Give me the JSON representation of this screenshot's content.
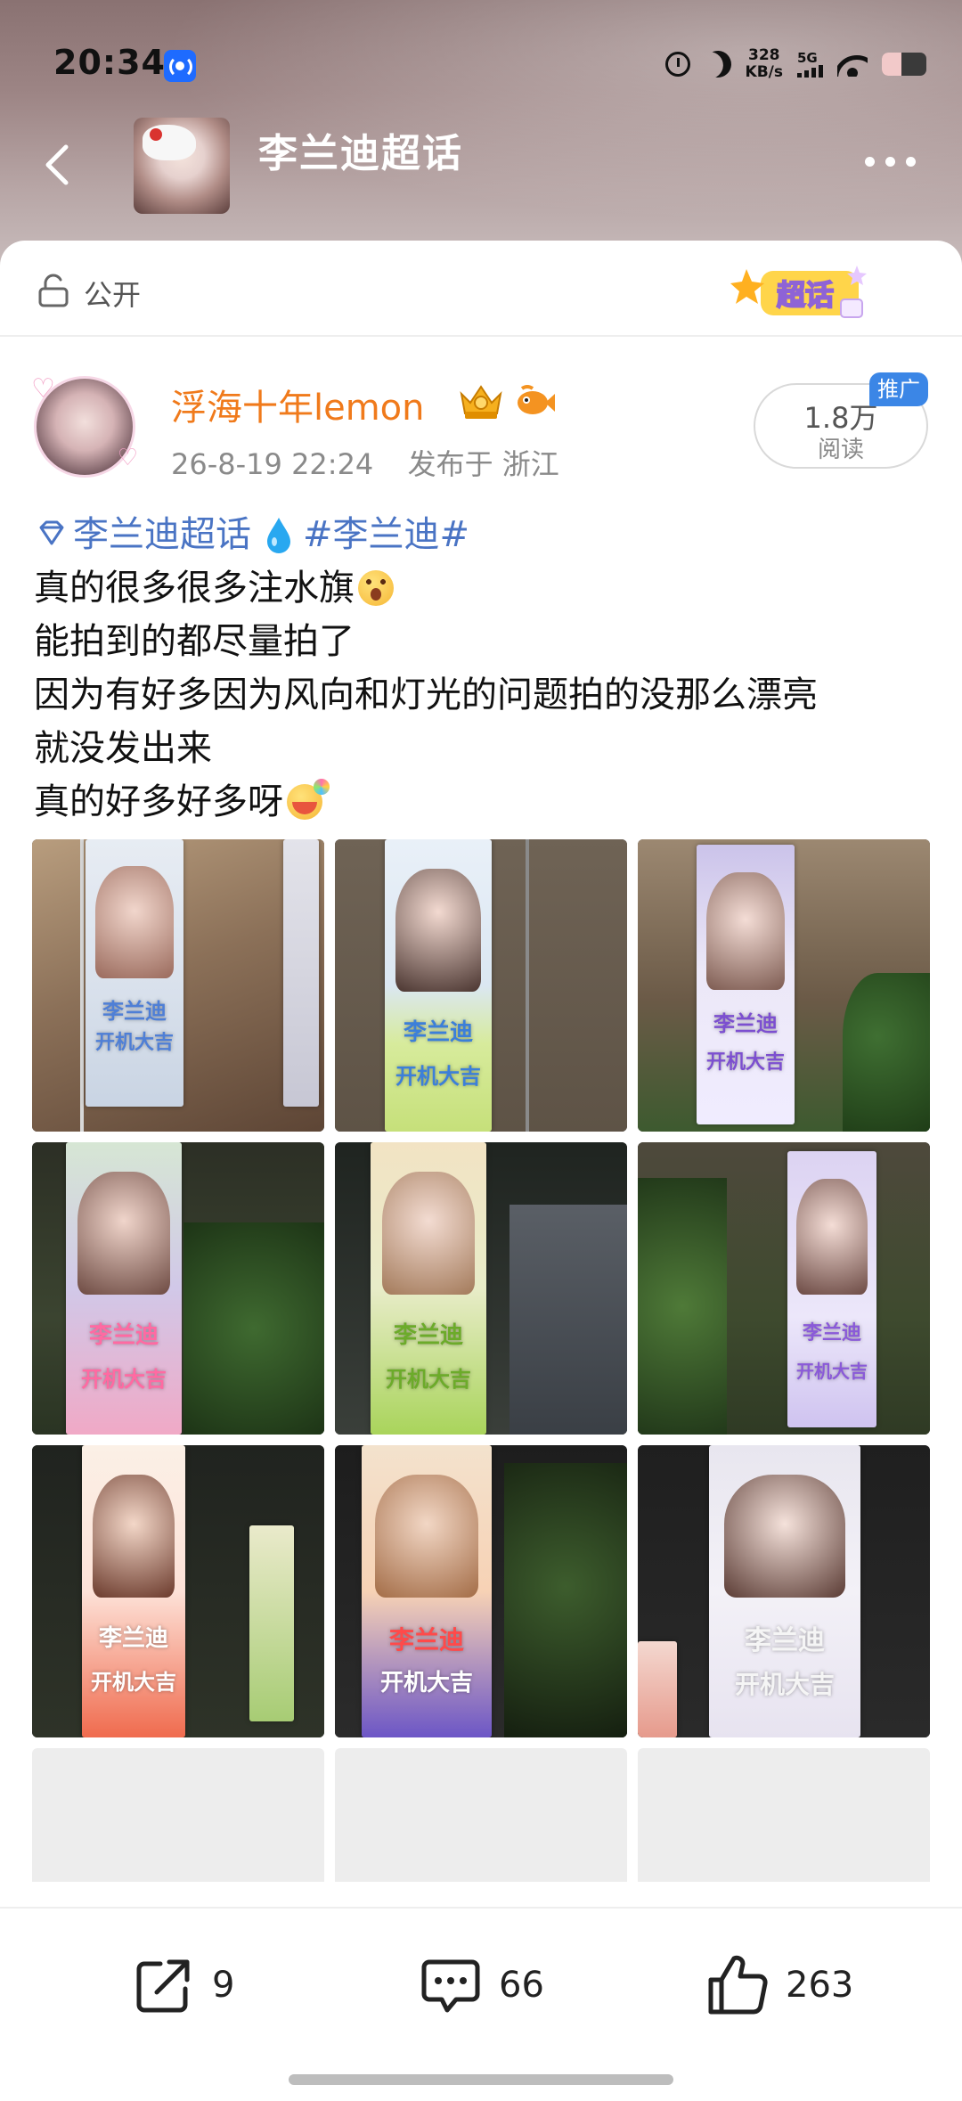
{
  "status_bar": {
    "time": "20:34",
    "net_speed_value": "328",
    "net_speed_unit": "KB/s",
    "network": "5G"
  },
  "nav": {
    "title": "李兰迪超话"
  },
  "visibility": {
    "label": "公开",
    "badge": "超话"
  },
  "post": {
    "username": "浮海十年lemon",
    "timestamp": "26-8-19 22:24",
    "location": "发布于 浙江",
    "views_count": "1.8万",
    "views_label": "阅读",
    "promo_tag": "推广",
    "supertopic_tag": "李兰迪超话",
    "hashtag": "#李兰迪#",
    "lines": [
      "真的很多很多注水旗",
      "能拍到的都尽量拍了",
      "因为有好多因为风向和灯光的问题拍的没那么漂亮",
      "就没发出来",
      "真的好多好多呀"
    ],
    "banner_name": "李兰迪",
    "banner_slogan": "开机大吉"
  },
  "actions": {
    "repost_count": "9",
    "comment_count": "66",
    "like_count": "263"
  },
  "colors": {
    "username": "#f07a1b",
    "link": "#4a74c4",
    "promo": "#3b86e6"
  },
  "icons": [
    "back-arrow-icon",
    "more-icon",
    "lock-icon",
    "chaohua-badge-icon",
    "vip-crown-icon",
    "fish-icon",
    "diamond-icon",
    "water-drop-icon",
    "share-icon",
    "comment-icon",
    "like-icon"
  ]
}
